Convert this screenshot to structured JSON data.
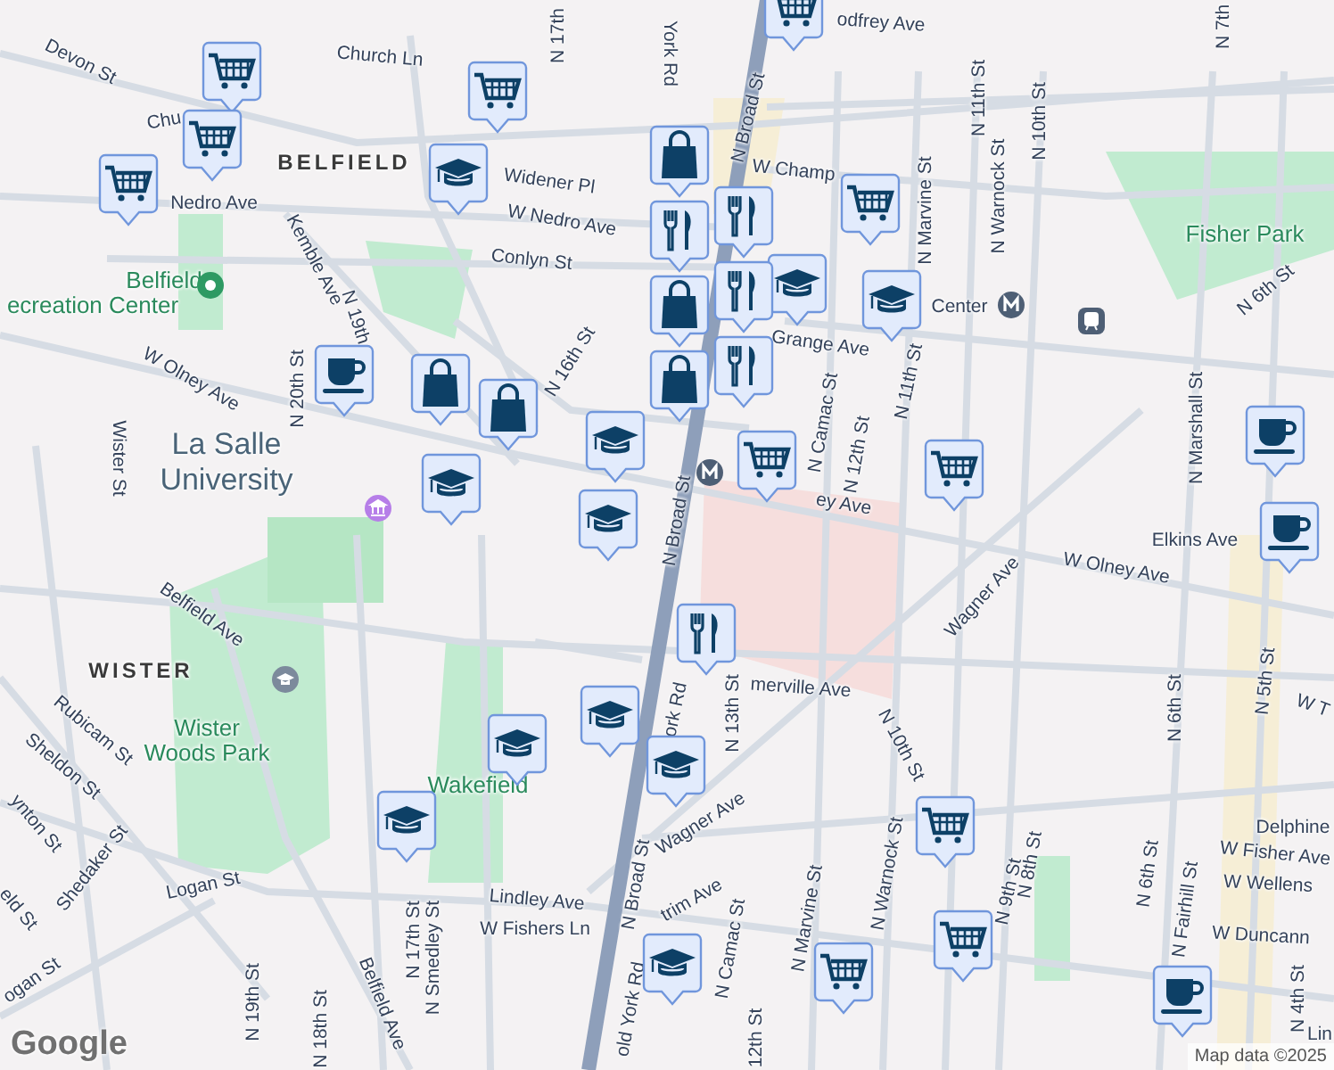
{
  "map": {
    "labels": [
      {
        "text": "Devon St",
        "kind": "street"
      },
      {
        "text": "Church Ln",
        "kind": "street"
      },
      {
        "text": "Chu",
        "kind": "street"
      },
      {
        "text": "BELFIELD",
        "kind": "area"
      },
      {
        "text": "Widener Pl",
        "kind": "street"
      },
      {
        "text": "W Nedro Ave",
        "kind": "street"
      },
      {
        "text": "Nedro Ave",
        "kind": "street"
      },
      {
        "text": "Conlyn St",
        "kind": "street"
      },
      {
        "text": "Kemble Ave",
        "kind": "street"
      },
      {
        "text": "N 19th",
        "kind": "street"
      },
      {
        "text": "N 20th St",
        "kind": "street"
      },
      {
        "text": "N 16th St",
        "kind": "street"
      },
      {
        "text": "W Olney Ave",
        "kind": "street"
      },
      {
        "text": "Wister St",
        "kind": "street"
      },
      {
        "text": "La Salle",
        "kind": "campus"
      },
      {
        "text": "University",
        "kind": "campus"
      },
      {
        "text": "Belfield",
        "kind": "park"
      },
      {
        "text": "ecreation Center",
        "kind": "park"
      },
      {
        "text": "York Rd",
        "kind": "street"
      },
      {
        "text": "N 17th",
        "kind": "street"
      },
      {
        "text": "N Broad St",
        "kind": "street"
      },
      {
        "text": "odfrey Ave",
        "kind": "street"
      },
      {
        "text": "N 11th St",
        "kind": "street"
      },
      {
        "text": "N Warnock St",
        "kind": "street"
      },
      {
        "text": "N 10th St",
        "kind": "street"
      },
      {
        "text": "N 7th",
        "kind": "street"
      },
      {
        "text": "W Champ",
        "kind": "street"
      },
      {
        "text": "N Marvine St",
        "kind": "street"
      },
      {
        "text": "Fisher Park",
        "kind": "park"
      },
      {
        "text": "Center",
        "kind": "street"
      },
      {
        "text": "Grange Ave",
        "kind": "street"
      },
      {
        "text": "N 6th St",
        "kind": "street"
      },
      {
        "text": "N Camac St",
        "kind": "street"
      },
      {
        "text": "N 12th St",
        "kind": "street"
      },
      {
        "text": "N 11th St",
        "kind": "street"
      },
      {
        "text": "N Marshall St",
        "kind": "street"
      },
      {
        "text": "ey Ave",
        "kind": "street"
      },
      {
        "text": "Elkins Ave",
        "kind": "street"
      },
      {
        "text": "W Olney Ave",
        "kind": "street"
      },
      {
        "text": "N Broad St",
        "kind": "street"
      },
      {
        "text": "Belfield Ave",
        "kind": "street"
      },
      {
        "text": "WISTER",
        "kind": "area"
      },
      {
        "text": "Wister",
        "kind": "park"
      },
      {
        "text": "Woods Park",
        "kind": "park"
      },
      {
        "text": "Rubicam St",
        "kind": "street"
      },
      {
        "text": "Sheldon St",
        "kind": "street"
      },
      {
        "text": "ynton St",
        "kind": "street"
      },
      {
        "text": "Shedaker St",
        "kind": "street"
      },
      {
        "text": "eld St",
        "kind": "street"
      },
      {
        "text": "Logan St",
        "kind": "street"
      },
      {
        "text": "ogan St",
        "kind": "street"
      },
      {
        "text": "Wakefield",
        "kind": "park"
      },
      {
        "text": "Lindley Ave",
        "kind": "street"
      },
      {
        "text": "W Fishers Ln",
        "kind": "street"
      },
      {
        "text": "N 19th St",
        "kind": "street"
      },
      {
        "text": "N 18th St",
        "kind": "street"
      },
      {
        "text": "Belfield Ave",
        "kind": "street"
      },
      {
        "text": "N 17th St",
        "kind": "street"
      },
      {
        "text": "N Smedley St",
        "kind": "street"
      },
      {
        "text": "N Broad St",
        "kind": "street"
      },
      {
        "text": "old York Rd",
        "kind": "street"
      },
      {
        "text": "Wagner Ave",
        "kind": "street"
      },
      {
        "text": "merville Ave",
        "kind": "street"
      },
      {
        "text": "N 13th St",
        "kind": "street"
      },
      {
        "text": "ork Rd",
        "kind": "street"
      },
      {
        "text": "N 10th St",
        "kind": "street"
      },
      {
        "text": "Wagner Ave",
        "kind": "street"
      },
      {
        "text": "trim Ave",
        "kind": "street"
      },
      {
        "text": "N Camac St",
        "kind": "street"
      },
      {
        "text": "N Marvine St",
        "kind": "street"
      },
      {
        "text": "N Warnock St",
        "kind": "street"
      },
      {
        "text": "N 9th St",
        "kind": "street"
      },
      {
        "text": "N 8th St",
        "kind": "street"
      },
      {
        "text": "N 6th St",
        "kind": "street"
      },
      {
        "text": "N 6th St",
        "kind": "street"
      },
      {
        "text": "N Fairhill St",
        "kind": "street"
      },
      {
        "text": "N 5th St",
        "kind": "street"
      },
      {
        "text": "W T",
        "kind": "street"
      },
      {
        "text": "Delphine",
        "kind": "street"
      },
      {
        "text": "W Fisher Ave",
        "kind": "street"
      },
      {
        "text": "W Wellens",
        "kind": "street"
      },
      {
        "text": "W Duncann",
        "kind": "street"
      },
      {
        "text": "N 4th St",
        "kind": "street"
      },
      {
        "text": "Lin",
        "kind": "street"
      },
      {
        "text": "12th St",
        "kind": "street"
      }
    ],
    "markers": [
      {
        "kind": "cart"
      },
      {
        "kind": "cart"
      },
      {
        "kind": "cart"
      },
      {
        "kind": "cart"
      },
      {
        "kind": "cart"
      },
      {
        "kind": "cart"
      },
      {
        "kind": "cart"
      },
      {
        "kind": "cart"
      },
      {
        "kind": "cart"
      },
      {
        "kind": "cart"
      },
      {
        "kind": "cart"
      },
      {
        "kind": "school"
      },
      {
        "kind": "school"
      },
      {
        "kind": "school"
      },
      {
        "kind": "school"
      },
      {
        "kind": "school"
      },
      {
        "kind": "school"
      },
      {
        "kind": "school"
      },
      {
        "kind": "school"
      },
      {
        "kind": "school"
      },
      {
        "kind": "school"
      },
      {
        "kind": "school"
      },
      {
        "kind": "cup"
      },
      {
        "kind": "cup"
      },
      {
        "kind": "cup"
      },
      {
        "kind": "cup"
      },
      {
        "kind": "bag"
      },
      {
        "kind": "bag"
      },
      {
        "kind": "bag"
      },
      {
        "kind": "bag"
      },
      {
        "kind": "bag"
      },
      {
        "kind": "restaurant"
      },
      {
        "kind": "restaurant"
      },
      {
        "kind": "restaurant"
      },
      {
        "kind": "restaurant"
      },
      {
        "kind": "restaurant"
      }
    ],
    "poi_icons": [
      {
        "kind": "metro"
      },
      {
        "kind": "metro"
      },
      {
        "kind": "train"
      },
      {
        "kind": "museum"
      },
      {
        "kind": "park"
      },
      {
        "kind": "school"
      }
    ]
  },
  "attribution": {
    "logo": "Google",
    "text": "Map data ©2025"
  }
}
